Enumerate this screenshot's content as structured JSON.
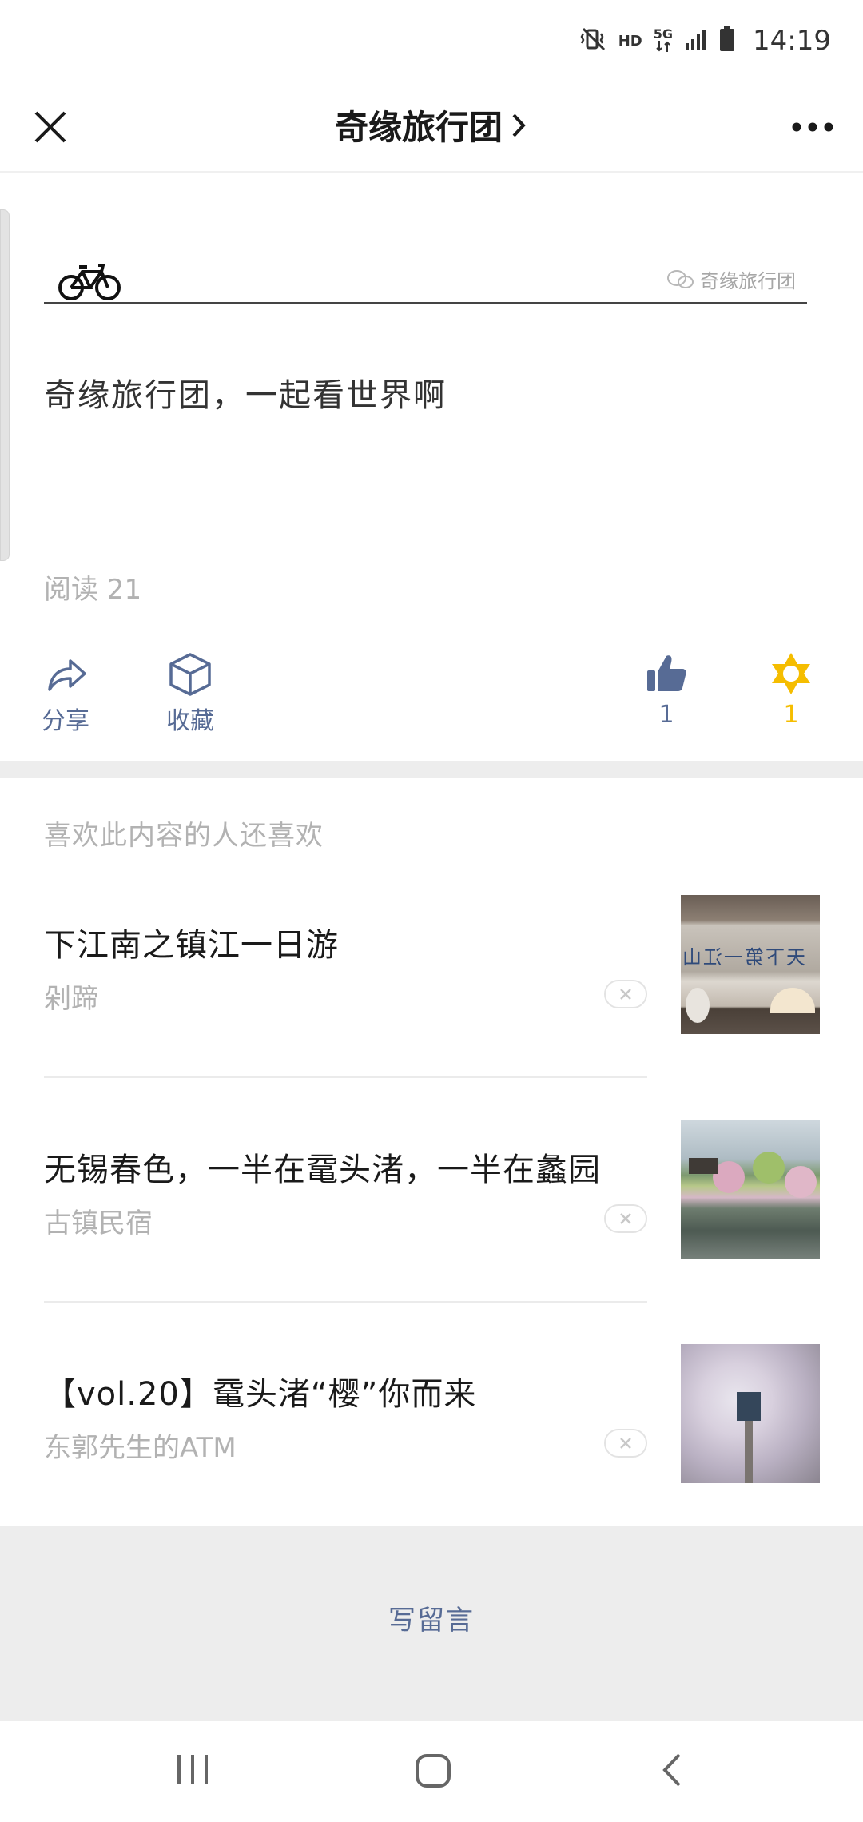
{
  "status_bar": {
    "time": "14:19",
    "hd_label": "HD",
    "network_label": "5G",
    "icons": [
      "vibrate-mute-icon",
      "hd-icon",
      "5g-icon",
      "signal-icon",
      "battery-icon"
    ]
  },
  "nav": {
    "title": "奇缘旅行团",
    "close_icon": "close-icon",
    "more_icon": "more-icon"
  },
  "article": {
    "banner_watermark": "奇缘旅行团",
    "body": "奇缘旅行团，一起看世界啊",
    "read_count": "阅读 21"
  },
  "actions": {
    "share_label": "分享",
    "favorite_label": "收藏",
    "like_count": "1",
    "wow_count": "1"
  },
  "recommendations": {
    "heading": "喜欢此内容的人还喜欢",
    "items": [
      {
        "title": "下江南之镇江一日游",
        "source": "剁蹄",
        "thumb_text": "天下第一江山"
      },
      {
        "title": "无锡春色，一半在鼋头渚，一半在蠡园",
        "source": "古镇民宿"
      },
      {
        "title": "【vol.20】鼋头渚“樱”你而来",
        "source": "东郭先生的ATM"
      }
    ]
  },
  "comment": {
    "label": "写留言"
  },
  "colors": {
    "link_blue": "#576b95",
    "wow_yellow": "#f5bd00",
    "muted_gray": "#b2b2b2",
    "divider_gray": "#ededed"
  }
}
